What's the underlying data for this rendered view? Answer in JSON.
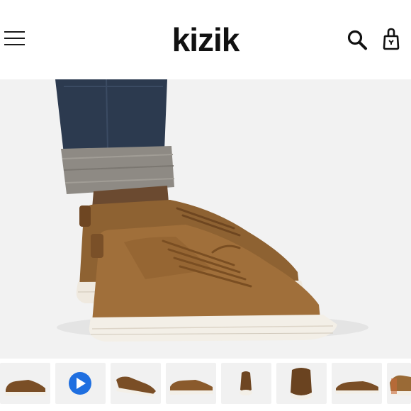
{
  "header": {
    "brand": "kizik",
    "menu_icon": "hamburger-menu-icon",
    "search_icon": "search-icon",
    "cart_icon": "shopping-bag-icon"
  },
  "hero": {
    "media": "product-photo-brown-leather-sneakers-on-model"
  },
  "gallery": {
    "thumbnails": [
      {
        "kind": "image",
        "view": "side"
      },
      {
        "kind": "video",
        "view": "play"
      },
      {
        "kind": "image",
        "view": "angled"
      },
      {
        "kind": "image",
        "view": "side-low"
      },
      {
        "kind": "image",
        "view": "top"
      },
      {
        "kind": "image",
        "view": "front"
      },
      {
        "kind": "image",
        "view": "side-alt"
      },
      {
        "kind": "image",
        "view": "back-partial"
      }
    ]
  },
  "colors": {
    "header_bg": "#ffffff",
    "hero_bg": "#f2f2f2",
    "shoe_leather": "#9a6a36",
    "sole": "#f3efe7",
    "jeans": "#2c3a4f",
    "play_button": "#1f6fe0"
  }
}
